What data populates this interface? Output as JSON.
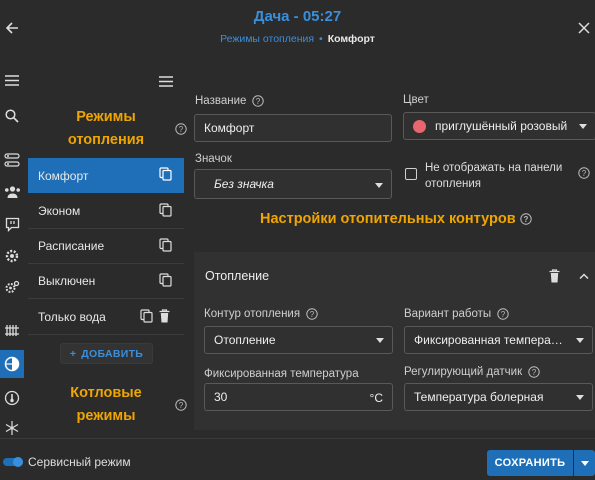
{
  "header": {
    "title": "Дача - 05:27",
    "breadcrumb": {
      "section": "Режимы отопления",
      "separator": "•",
      "current": "Комфорт"
    }
  },
  "rail": {
    "icons": [
      "menu-icon",
      "search-icon",
      "devices-icon",
      "users-icon",
      "messages-icon",
      "gear-icon",
      "settings-icon",
      "radiator-icon",
      "heating-modes-icon",
      "thermometer-icon",
      "snowflake-icon"
    ],
    "active": "heating-modes-icon"
  },
  "list": {
    "heating_title_1": "Режимы",
    "heating_title_2": "отопления",
    "items": [
      {
        "label": "Комфорт",
        "selected": true,
        "deletable": false
      },
      {
        "label": "Эконом",
        "selected": false,
        "deletable": false
      },
      {
        "label": "Расписание",
        "selected": false,
        "deletable": false
      },
      {
        "label": "Выключен",
        "selected": false,
        "deletable": false
      },
      {
        "label": "Только вода",
        "selected": false,
        "deletable": true
      }
    ],
    "add_label": "ДОБАВИТЬ",
    "boiler_title_1": "Котловые",
    "boiler_title_2": "режимы"
  },
  "form": {
    "name_label": "Название",
    "name_value": "Комфорт",
    "color_label": "Цвет",
    "color_value": "приглушённый розовый",
    "color_swatch": "#e8666d",
    "icon_label": "Значок",
    "icon_value": "Без значка",
    "hide_label_1": "Не отображать на панели",
    "hide_label_2": "отопления",
    "hide_checked": false,
    "circuits_title": "Настройки отопительных контуров",
    "circuit": {
      "title": "Отопление",
      "contour_label": "Контур отопления",
      "contour_value": "Отопление",
      "mode_label": "Вариант работы",
      "mode_value": "Фиксированная темпера…",
      "temp_label": "Фиксированная температура",
      "temp_value": "30",
      "temp_unit": "°C",
      "sensor_label": "Регулирующий датчик",
      "sensor_value": "Температура болерная"
    }
  },
  "footer": {
    "service_label": "Сервисный режим",
    "service_on": true,
    "save_label": "СОХРАНИТЬ"
  },
  "colors": {
    "accent": "#1e6fb8",
    "link": "#3a8fdc",
    "heading": "#f0a500",
    "background": "#2b2b2b"
  }
}
